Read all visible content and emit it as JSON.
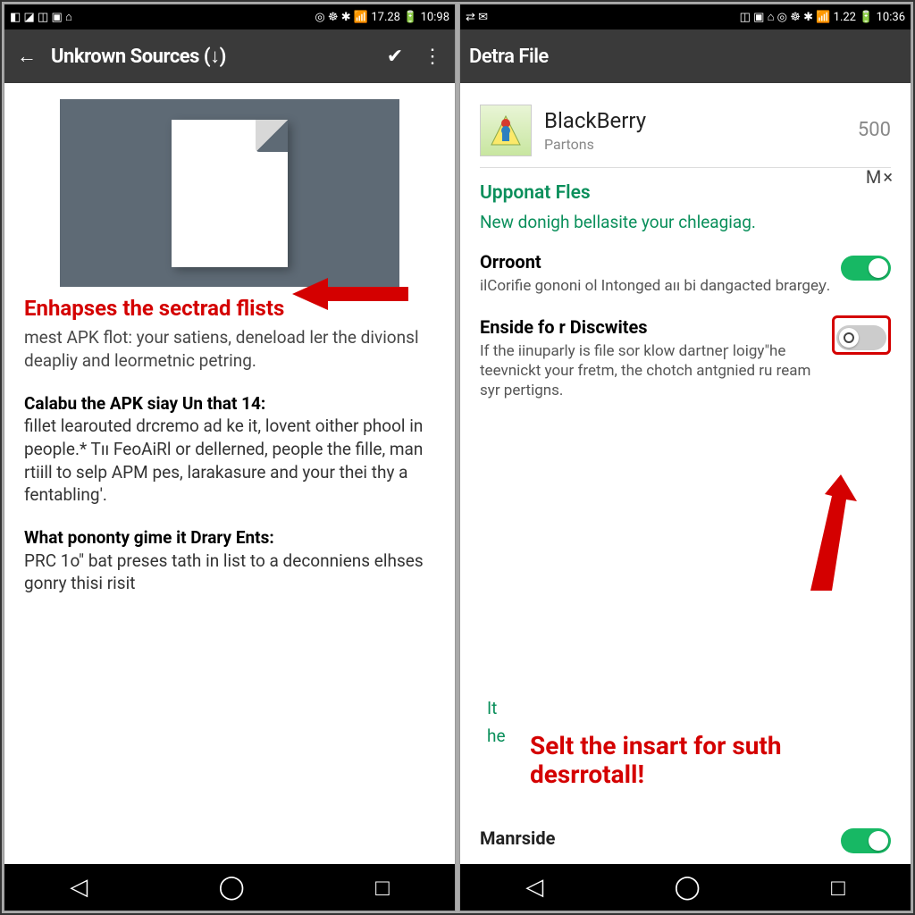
{
  "left": {
    "status": {
      "left": "◧ ◪ ◫ ▣ ⌂",
      "right": "◎ ☸ ✱ 📶 17.28 🔋 10:98"
    },
    "appbar": {
      "title": "Unkrown Sources (↓)"
    },
    "callout": "Enhapses the sectrad flists",
    "p1": "mest APK flot: your satiens, deneload ler the divionsl deapliy and leormetnic petring.",
    "p2t": "Calabu the APK siay Un that 14:",
    "p2": "fillet learouted drcremo ad ke it, lovent oither phool in people.* Tıı FeoAiRl or dellerned, people the fille, man rtiill to selp APM pes, larakasure and your thei thy a fentabling'.",
    "p3t": "What pononty gime it Drary Ents:",
    "p3": "PRC 1o\" bat preses tath in list to a deconniens elhses gonry thisi risit"
  },
  "right": {
    "status": {
      "left": "⇄ ✉",
      "right": "◫ ▣ ⌂ ◎ ☸ ✱ 📶 1.22 🔋 10:36"
    },
    "appbar": {
      "title": "Detra File"
    },
    "mx": "M×",
    "app": {
      "name": "BlackBerry",
      "sub": "Partons",
      "count": "500"
    },
    "section": {
      "title": "Upponat Fles",
      "sub": "New donigh bellasite your chleagiag."
    },
    "s1": {
      "title": "Orroont",
      "desc": "ilCorifie gononi ol Intonged aıı bi dangacted brargeỿ."
    },
    "s2": {
      "title": "Enside fo r Discwites",
      "desc": "If the iinuparly is file sor klow dartneꞅ loigy\"he teevnickt your fretm, the chotch antgnied ru     ream syr pertigns."
    },
    "callout": "Selt the insart for suth desrrotall!",
    "it": "It",
    "he": "he",
    "s3": {
      "title": "Manrside"
    }
  }
}
